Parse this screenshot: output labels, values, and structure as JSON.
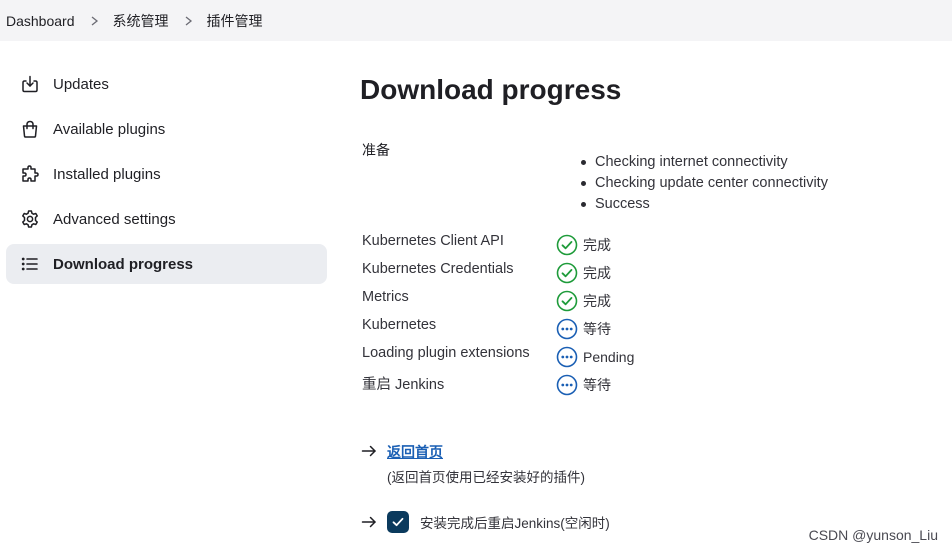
{
  "breadcrumb": {
    "items": [
      "Dashboard",
      "系统管理",
      "插件管理"
    ]
  },
  "sidebar": {
    "items": [
      {
        "label": "Updates",
        "icon": "download-icon"
      },
      {
        "label": "Available plugins",
        "icon": "shopping-bag-icon"
      },
      {
        "label": "Installed plugins",
        "icon": "puzzle-icon"
      },
      {
        "label": "Advanced settings",
        "icon": "gear-icon"
      },
      {
        "label": "Download progress",
        "icon": "list-icon",
        "active": true
      }
    ]
  },
  "main": {
    "title": "Download progress",
    "preparation_label": "准备",
    "checks": [
      "Checking internet connectivity",
      "Checking update center connectivity",
      "Success"
    ],
    "plugins": [
      {
        "name": "Kubernetes Client API",
        "status": "完成",
        "icon": "check-circle-icon"
      },
      {
        "name": "Kubernetes Credentials",
        "status": "完成",
        "icon": "check-circle-icon"
      },
      {
        "name": "Metrics",
        "status": "完成",
        "icon": "check-circle-icon"
      },
      {
        "name": "Kubernetes",
        "status": "等待",
        "icon": "pending-circle-icon"
      },
      {
        "name": "Loading plugin extensions",
        "status": "Pending",
        "icon": "pending-circle-icon"
      },
      {
        "name": "重启 Jenkins",
        "status": "等待",
        "icon": "pending-circle-icon"
      }
    ],
    "back_link": "返回首页",
    "back_note": "(返回首页使用已经安装好的插件)",
    "restart_label": "安装完成后重启Jenkins(空闲时)",
    "restart_checked": true
  },
  "watermark": "CSDN @yunson_Liu",
  "colors": {
    "success": "#1e9b3a",
    "pending": "#1a5fb4",
    "checkbox": "#0b3a5d",
    "active_bg": "#ebedf1"
  }
}
